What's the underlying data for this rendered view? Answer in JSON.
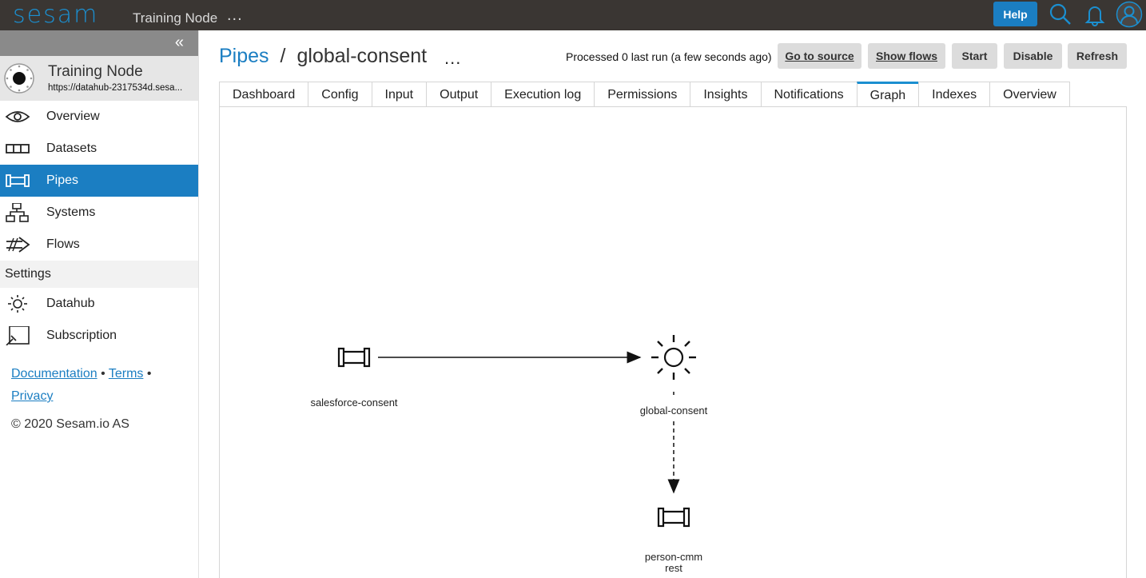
{
  "topbar": {
    "logo": "sesam",
    "node_title": "Training Node",
    "more": "...",
    "help_label": "Help",
    "icons": [
      "search-icon",
      "bell-icon",
      "user-avatar-icon"
    ]
  },
  "sidebar": {
    "collapse_icon": "«",
    "node": {
      "name": "Training Node",
      "url": "https://datahub-2317534d.sesa..."
    },
    "items": [
      {
        "label": "Overview",
        "icon": "eye-icon"
      },
      {
        "label": "Datasets",
        "icon": "dataset-icon"
      },
      {
        "label": "Pipes",
        "icon": "pipe-icon",
        "active": true
      },
      {
        "label": "Systems",
        "icon": "systems-icon"
      },
      {
        "label": "Flows",
        "icon": "flows-icon"
      }
    ],
    "settings_heading": "Settings",
    "settings_items": [
      {
        "label": "Datahub",
        "icon": "datahub-icon"
      },
      {
        "label": "Subscription",
        "icon": "subscription-icon"
      }
    ],
    "footer": {
      "documentation": "Documentation",
      "dot1": "•",
      "terms": "Terms",
      "dot2": "•",
      "privacy": "Privacy",
      "copyright": "© 2020 Sesam.io AS"
    }
  },
  "header": {
    "crumb_root": "Pipes",
    "crumb_sep": "/",
    "crumb_current": "global-consent",
    "more": "...",
    "processed": "Processed 0 last run (a few seconds ago)",
    "buttons": {
      "go_to_source": "Go to source",
      "show_flows": "Show flows",
      "start": "Start",
      "disable": "Disable",
      "refresh": "Refresh"
    }
  },
  "tabs": [
    {
      "label": "Dashboard"
    },
    {
      "label": "Config"
    },
    {
      "label": "Input"
    },
    {
      "label": "Output"
    },
    {
      "label": "Execution log"
    },
    {
      "label": "Permissions"
    },
    {
      "label": "Insights"
    },
    {
      "label": "Notifications"
    },
    {
      "label": "Graph",
      "active": true
    },
    {
      "label": "Indexes"
    },
    {
      "label": "Overview"
    }
  ],
  "graph": {
    "nodes": {
      "source": {
        "label": "salesforce-consent",
        "icon": "pipe-icon"
      },
      "current": {
        "label": "global-consent",
        "icon": "sun-pipe-icon"
      },
      "target": {
        "label_line1": "person-cmm",
        "label_line2": "rest",
        "icon": "pipe-icon"
      }
    }
  }
}
